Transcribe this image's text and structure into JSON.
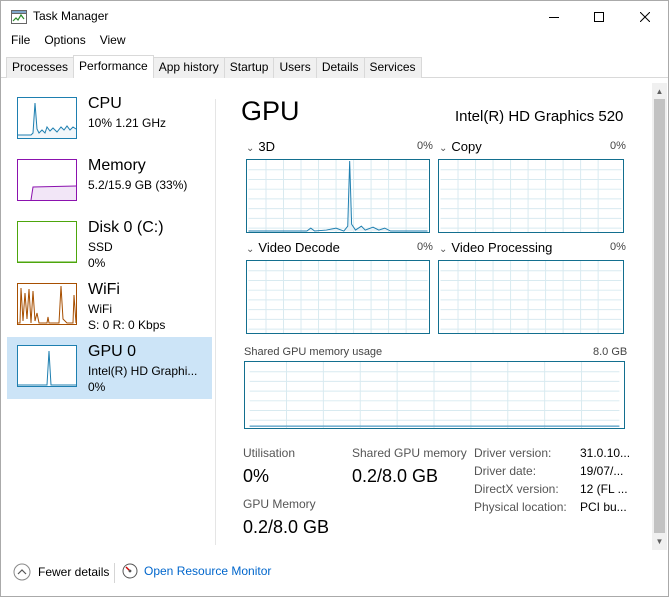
{
  "window": {
    "title": "Task Manager"
  },
  "menu": [
    "File",
    "Options",
    "View"
  ],
  "tabs": [
    "Processes",
    "Performance",
    "App history",
    "Startup",
    "Users",
    "Details",
    "Services"
  ],
  "active_tab": "Performance",
  "resources": [
    {
      "name": "CPU",
      "line2": "10% 1.21 GHz",
      "line3": "",
      "color": "#1e7fb0",
      "icon": "cpu-sparkline"
    },
    {
      "name": "Memory",
      "line2": "5.2/15.9 GB (33%)",
      "line3": "",
      "color": "#8b12ae",
      "icon": "memory-sparkline"
    },
    {
      "name": "Disk 0 (C:)",
      "line2": "SSD",
      "line3": "0%",
      "color": "#4da60c",
      "icon": "disk-sparkline"
    },
    {
      "name": "WiFi",
      "line2": "WiFi",
      "line3": "S: 0 R: 0 Kbps",
      "color": "#a74f01",
      "icon": "wifi-sparkline"
    },
    {
      "name": "GPU 0",
      "line2": "Intel(R) HD Graphi...",
      "line3": "0%",
      "color": "#1e7fb0",
      "icon": "gpu-sparkline"
    }
  ],
  "detail": {
    "title": "GPU",
    "model": "Intel(R) HD Graphics 520",
    "engines": [
      {
        "label": "3D",
        "pct": "0%"
      },
      {
        "label": "Copy",
        "pct": "0%"
      },
      {
        "label": "Video Decode",
        "pct": "0%"
      },
      {
        "label": "Video Processing",
        "pct": "0%"
      }
    ],
    "shared_mem_label": "Shared GPU memory usage",
    "shared_mem_max": "8.0 GB",
    "stats": {
      "utilisation_label": "Utilisation",
      "utilisation_value": "0%",
      "shared_label": "Shared GPU memory",
      "shared_value": "0.2/8.0 GB",
      "gpumem_label": "GPU Memory",
      "gpumem_value": "0.2/8.0 GB"
    },
    "info": [
      {
        "k": "Driver version:",
        "v": "31.0.10..."
      },
      {
        "k": "Driver date:",
        "v": "19/07/..."
      },
      {
        "k": "DirectX version:",
        "v": "12 (FL ..."
      },
      {
        "k": "Physical location:",
        "v": "PCI bu..."
      }
    ]
  },
  "footer": {
    "fewer_details": "Fewer details",
    "open_resource_monitor": "Open Resource Monitor",
    "link_color": "#0066cc"
  }
}
